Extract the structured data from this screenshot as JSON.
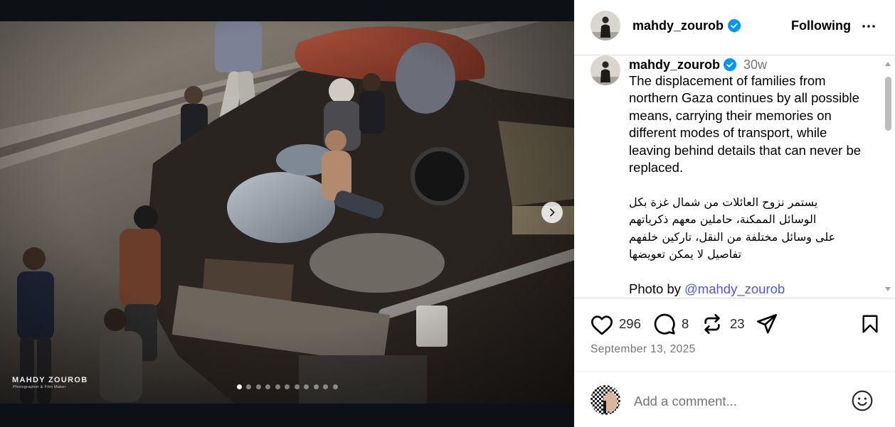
{
  "colors": {
    "verified": "#0095f6",
    "link": "#4f5bd5",
    "muted": "#737373",
    "border": "#dbdbdb",
    "media_bg": "#0d1015"
  },
  "header": {
    "username": "mahdy_zourob",
    "verified": true,
    "follow_label": "Following",
    "more_icon": "more-options-icon"
  },
  "media": {
    "slide_count": 11,
    "active_slide": 1,
    "watermark": "MAHDY ZOUROB",
    "watermark_tagline": "Photographer & Film Maker",
    "next_icon": "chevron-right-icon"
  },
  "caption": {
    "username": "mahdy_zourob",
    "verified": true,
    "age": "30w",
    "english_lines": [
      "The displacement of families from",
      "northern Gaza continues by all possible",
      "means, carrying their memories on",
      "different modes of transport, while",
      "leaving behind details that can never be",
      "replaced."
    ],
    "arabic_lines": [
      "يستمر نزوح العائلات من شمال غزة بكل",
      "الوسائل الممكنة، حاملين معهم ذكرياتهم",
      "على وسائل مختلفة من النقل، تاركين خلفهم",
      "تفاصيل لا يمكن تعويضها"
    ],
    "credit_prefix": "Photo by",
    "credit_handle": "@mahdy_zourob"
  },
  "actions": {
    "like_icon": "heart-icon",
    "likes": "296",
    "comment_icon": "comment-icon",
    "comments": "8",
    "repost_icon": "repost-icon",
    "reposts": "23",
    "share_icon": "share-icon",
    "save_icon": "bookmark-icon"
  },
  "date": "September 13, 2025",
  "comment_box": {
    "placeholder": "Add a comment...",
    "emoji_icon": "emoji-icon"
  }
}
